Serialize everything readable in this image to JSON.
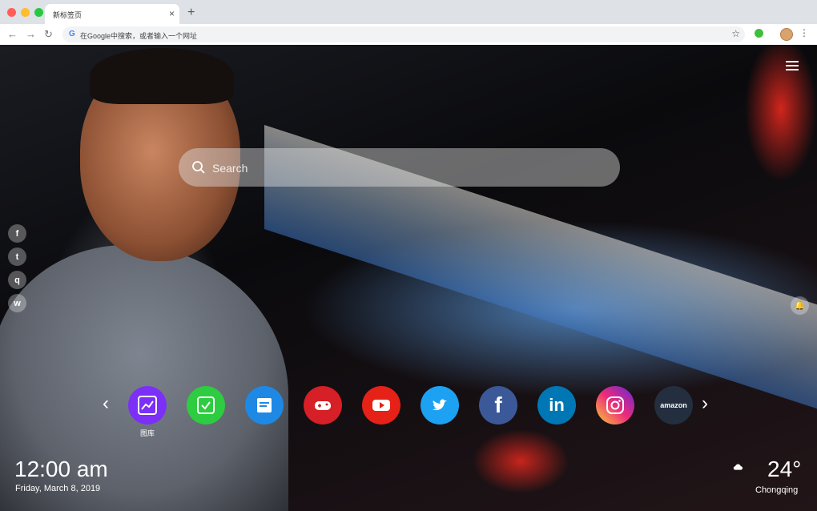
{
  "browser": {
    "tab_title": "新标签页",
    "tab_close": "×",
    "new_tab": "+",
    "omnibox_text": "在Google中搜索，或者输入一个网址",
    "back": "←",
    "forward": "→",
    "reload": "↻",
    "star": "☆",
    "menu": "⋮",
    "traffic_colors": [
      "#ff5f57",
      "#febc2e",
      "#28c840"
    ]
  },
  "search": {
    "placeholder": "Search"
  },
  "social_icons": [
    "f",
    "t",
    "q",
    "w"
  ],
  "apps": [
    {
      "icon": "chart-icon",
      "color": "#7b2ff7",
      "label": "图库"
    },
    {
      "icon": "check-icon",
      "color": "#2ecc40",
      "label": ""
    },
    {
      "icon": "note-icon",
      "color": "#1e88e5",
      "label": ""
    },
    {
      "icon": "gamepad-icon",
      "color": "#d61f26",
      "label": ""
    },
    {
      "icon": "youtube-icon",
      "color": "#e62117",
      "label": ""
    },
    {
      "icon": "twitter-icon",
      "color": "#1da1f2",
      "label": ""
    },
    {
      "icon": "facebook-icon",
      "color": "#3b5998",
      "label": ""
    },
    {
      "icon": "linkedin-icon",
      "color": "#0077b5",
      "label": ""
    },
    {
      "icon": "instagram-icon",
      "color": "#e1306c",
      "label": ""
    },
    {
      "icon": "amazon-icon",
      "color": "#232f3e",
      "label": "amazon"
    }
  ],
  "clock": {
    "time": "12:00 am",
    "date": "Friday, March 8, 2019"
  },
  "weather": {
    "temp": "24°",
    "city": "Chongqing"
  }
}
